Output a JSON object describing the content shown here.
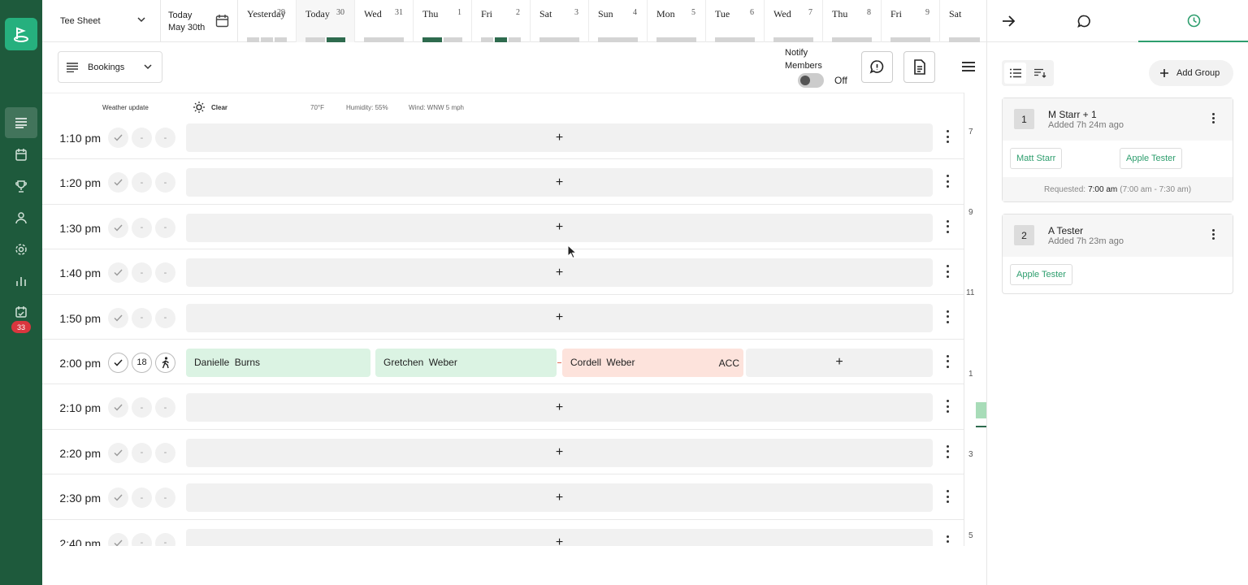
{
  "app": {
    "badge_count": "33"
  },
  "rail": {
    "items": [
      "logo-icon",
      "tee-sheet-icon",
      "calendar-icon",
      "trophy-icon",
      "user-icon",
      "gear-icon",
      "chart-icon",
      "events-icon"
    ]
  },
  "topbar": {
    "sheet_label": "Tee Sheet",
    "today_line1": "Today",
    "today_line2": "May 30th",
    "days": [
      {
        "name": "Yesterday",
        "num": "29"
      },
      {
        "name": "Today",
        "num": "30"
      },
      {
        "name": "Wed",
        "num": "31"
      },
      {
        "name": "Thu",
        "num": "1"
      },
      {
        "name": "Fri",
        "num": "2"
      },
      {
        "name": "Sat",
        "num": "3"
      },
      {
        "name": "Sun",
        "num": "4"
      },
      {
        "name": "Mon",
        "num": "5"
      },
      {
        "name": "Tue",
        "num": "6"
      },
      {
        "name": "Wed",
        "num": "7"
      },
      {
        "name": "Thu",
        "num": "8"
      },
      {
        "name": "Fri",
        "num": "9"
      },
      {
        "name": "Sat",
        "num": ""
      }
    ]
  },
  "toolbar": {
    "view_label": "Bookings",
    "notify_line1": "Notify",
    "notify_line2": "Members",
    "toggle_state": "Off"
  },
  "weather": {
    "label": "Weather update",
    "condition": "Clear",
    "temp": "70°F",
    "humidity": "Humidity: 55%",
    "wind": "Wind: WNW 5 mph"
  },
  "rows": [
    {
      "time": "1:10 pm",
      "plus": "+",
      "dash": "-"
    },
    {
      "time": "1:20 pm",
      "plus": "+",
      "dash": "-"
    },
    {
      "time": "1:30 pm",
      "plus": "+",
      "dash": "-"
    },
    {
      "time": "1:40 pm",
      "plus": "+",
      "dash": "-"
    },
    {
      "time": "1:50 pm",
      "plus": "+",
      "dash": "-"
    },
    {
      "time": "2:00 pm",
      "holes": "18",
      "players": [
        "Danielle  Burns",
        "Gretchen  Weber",
        "Cordell  Weber"
      ],
      "acc": "ACC",
      "plus": "+"
    },
    {
      "time": "2:10 pm",
      "plus": "+",
      "dash": "-"
    },
    {
      "time": "2:20 pm",
      "plus": "+",
      "dash": "-"
    },
    {
      "time": "2:30 pm",
      "plus": "+",
      "dash": "-"
    },
    {
      "time": "2:40 pm",
      "plus": "+",
      "dash": "-"
    }
  ],
  "ruler": {
    "hours": [
      "7",
      "9",
      "11",
      "1",
      "3",
      "5"
    ]
  },
  "panel": {
    "add_group_label": "Add Group",
    "groups": [
      {
        "num": "1",
        "name": "M Starr + 1",
        "added": "Added 7h 24m ago",
        "chips": [
          "Matt Starr",
          "Apple Tester"
        ],
        "requested_label": "Requested:",
        "requested_time": "7:00 am",
        "requested_range": "(7:00 am - 7:30 am)"
      },
      {
        "num": "2",
        "name": "A Tester",
        "added": "Added 7h 23m ago",
        "chips": [
          "Apple Tester"
        ]
      }
    ]
  }
}
